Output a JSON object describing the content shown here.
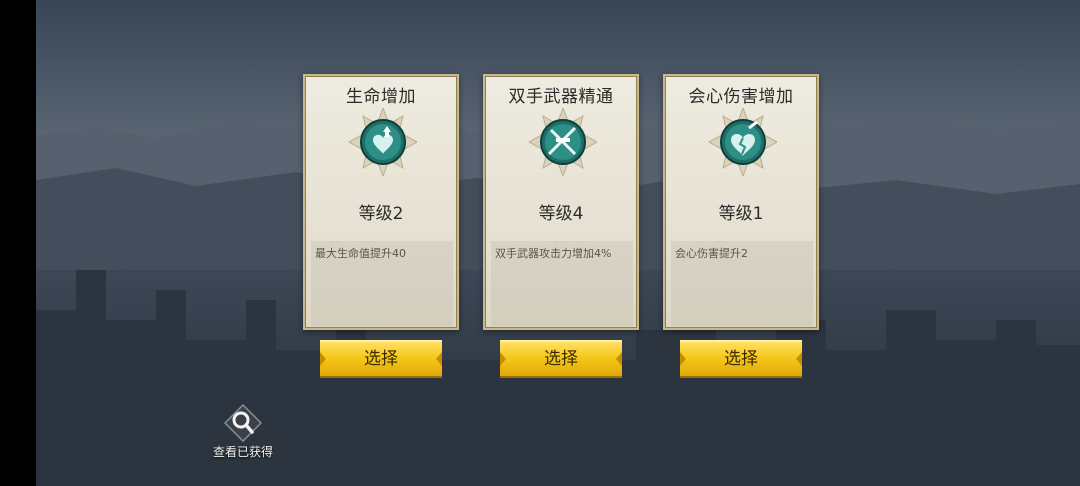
{
  "cards": [
    {
      "title": "生命增加",
      "level": "等级2",
      "description": "最大生命值提升40",
      "icon": "heart-arrow-up-icon",
      "button": "选择"
    },
    {
      "title": "双手武器精通",
      "level": "等级4",
      "description": "双手武器攻击力增加4%",
      "icon": "crossed-swords-icon",
      "button": "选择"
    },
    {
      "title": "会心伤害增加",
      "level": "等级1",
      "description": "会心伤害提升2",
      "icon": "broken-heart-sword-icon",
      "button": "选择"
    }
  ],
  "view_obtained": {
    "label": "查看已获得",
    "icon": "magnifier-icon"
  },
  "colors": {
    "emblem_teal": "#1f6f68",
    "button_gold": "#f6c81b",
    "card_bg": "#e6e1d3"
  }
}
